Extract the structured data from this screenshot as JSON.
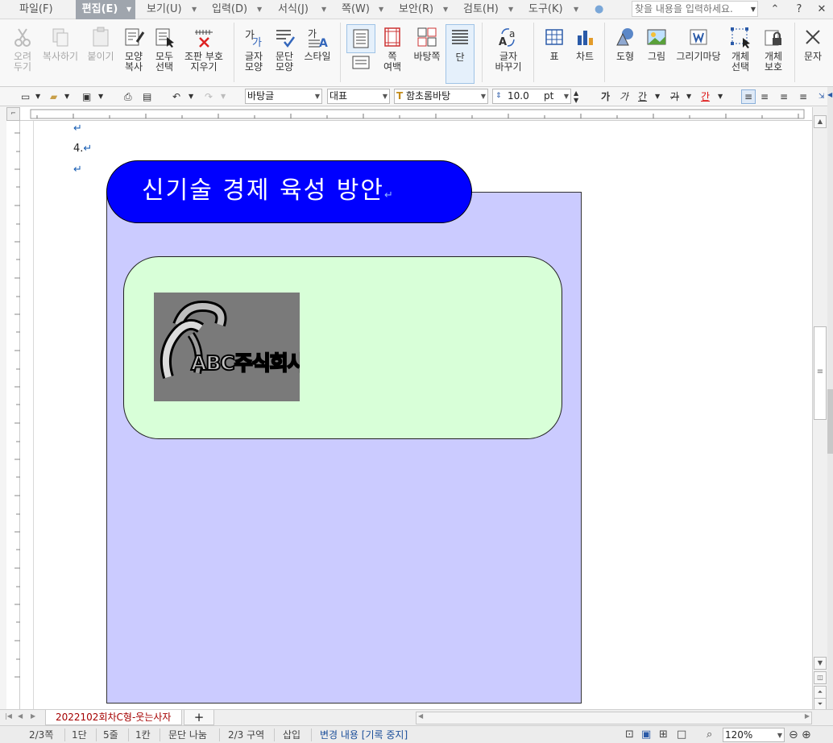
{
  "menu": {
    "items": [
      "파일(F)",
      "편집(E)",
      "보기(U)",
      "입력(D)",
      "서식(J)",
      "쪽(W)",
      "보안(R)",
      "검토(H)",
      "도구(K)"
    ],
    "search_placeholder": "찾을 내용을 입력하세요."
  },
  "ribbon": {
    "cut": "오려\n두기",
    "copy": "복사하기",
    "paste": "붙이기",
    "format_copy": "모양\n복사",
    "select_all": "모두\n선택",
    "clear_marks": "조판 부호\n지우기",
    "char_shape": "글자\n모양",
    "para_shape": "문단\n모양",
    "style": "스타일",
    "page_margin": "쪽\n여백",
    "background": "바탕쪽",
    "column": "단",
    "char_change": "글자\n바꾸기",
    "table": "표",
    "chart": "차트",
    "shape": "도형",
    "picture": "그림",
    "gallery": "그리기마당",
    "object_select": "개체\n선택",
    "object_protect": "개체\n보호",
    "text": "문자"
  },
  "toolbar": {
    "style_name": "바탕글",
    "lang": "대표",
    "font": "함초롬바탕",
    "font_size": "10.0",
    "size_unit": "pt",
    "bold": "가",
    "italic": "가",
    "underline": "간",
    "strike": "가",
    "color": "간"
  },
  "document": {
    "list_number": "4.",
    "title": "신기술 경제 육성 방안",
    "logo_text": "ABC주식회사"
  },
  "tabs": {
    "doc_tab": "2022102회차C형-웃는사자",
    "add": "+"
  },
  "status": {
    "page": "2/3쪽",
    "column": "1단",
    "line": "5줄",
    "col": "1칸",
    "para_break": "문단 나눔",
    "section": "2/3 구역",
    "insert": "삽입",
    "track": "변경 내용 [기록 중지]",
    "zoom": "120%"
  },
  "colors": {
    "banner": "#0000ff",
    "outer_box": "#cbcbff",
    "inner_box": "#d8ffd8",
    "tab_text": "#a50000"
  }
}
